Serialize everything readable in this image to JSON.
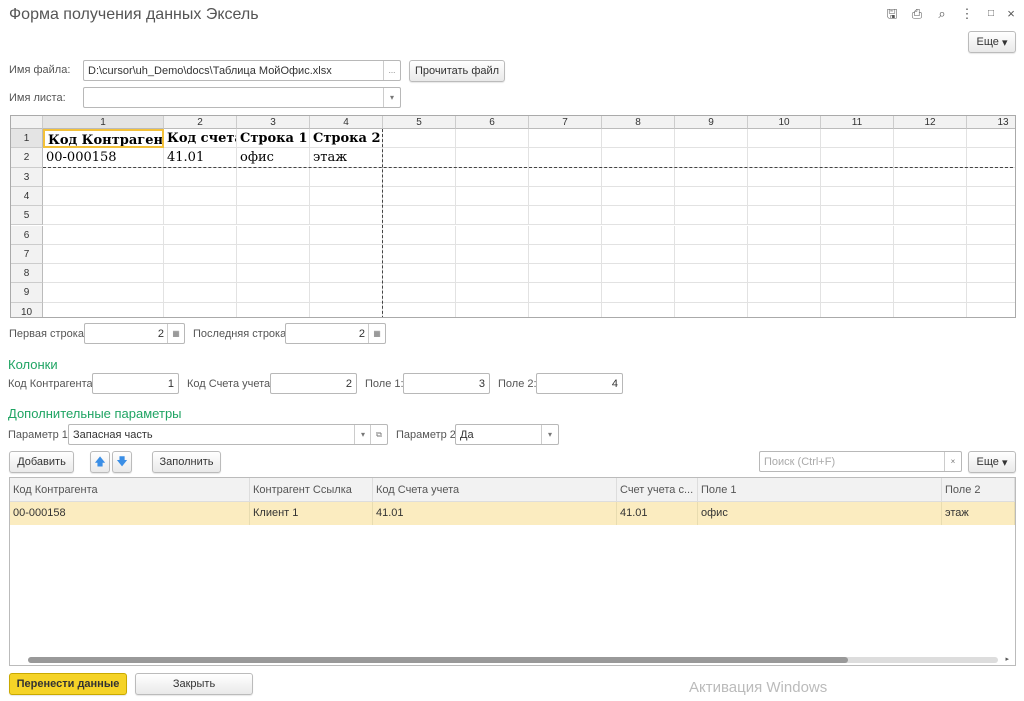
{
  "window": {
    "title": "Форма получения данных Эксель",
    "icons": [
      "save-icon",
      "print-icon",
      "preview-icon",
      "more-icon",
      "restore-icon",
      "close-icon"
    ]
  },
  "more_label": "Еще",
  "file": {
    "label": "Имя файла:",
    "value": "D:\\cursor\\uh_Demo\\docs\\Таблица МойОфис.xlsx",
    "browse": "...",
    "read_button": "Прочитать файл"
  },
  "sheet_name": {
    "label": "Имя листа:",
    "value": ""
  },
  "spreadsheet": {
    "columns": [
      "1",
      "2",
      "3",
      "4",
      "5",
      "6",
      "7",
      "8",
      "9",
      "10",
      "11",
      "12",
      "13"
    ],
    "rows": [
      "1",
      "2",
      "3",
      "4",
      "5",
      "6",
      "7",
      "8",
      "9",
      "10"
    ],
    "cells": [
      [
        "Код Контрагента",
        "Код счета",
        "Строка 1",
        "Строка 2"
      ],
      [
        "00-000158",
        "41.01",
        "офис",
        "этаж"
      ]
    ]
  },
  "first_row": {
    "label": "Первая строка:",
    "value": "2"
  },
  "last_row": {
    "label": "Последняя строка:",
    "value": "2"
  },
  "columns_section": {
    "title": "Колонки",
    "fields": [
      {
        "label": "Код Контрагента:",
        "value": "1"
      },
      {
        "label": "Код Счета учета:",
        "value": "2"
      },
      {
        "label": "Поле 1:",
        "value": "3"
      },
      {
        "label": "Поле 2:",
        "value": "4"
      }
    ]
  },
  "extra": {
    "title": "Дополнительные параметры",
    "param1_label": "Параметр 1:",
    "param1_value": "Запасная часть",
    "param2_label": "Параметр 2:",
    "param2_value": "Да"
  },
  "toolbar": {
    "add": "Добавить",
    "fill": "Заполнить",
    "search_placeholder": "Поиск (Ctrl+F)",
    "clear": "×"
  },
  "table": {
    "headers": [
      "Код Контрагента",
      "Контрагент Ссылка",
      "Код Счета учета",
      "Счет учета с...",
      "Поле 1",
      "Поле 2"
    ],
    "rows": [
      [
        "00-000158",
        "Клиент 1",
        "41.01",
        "41.01",
        "офис",
        "этаж"
      ]
    ]
  },
  "footer": {
    "transfer": "Перенести данные",
    "close": "Закрыть",
    "watermark": "Активация Windows"
  },
  "colors": {
    "accent_green": "#1fa463",
    "primary_button": "#f5d327",
    "selected_row": "#fbecc0",
    "cell_highlight": "#f3c13a"
  }
}
